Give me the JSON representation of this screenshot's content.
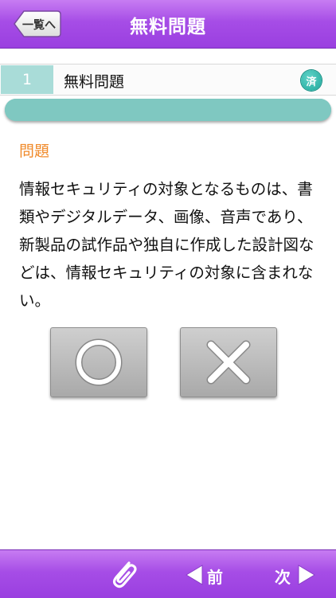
{
  "header": {
    "title": "無料問題",
    "back_label": "一覧へ"
  },
  "question": {
    "number": "1",
    "title": "無料問題",
    "status_badge": "済",
    "progress": 1.0,
    "section_label": "問題",
    "text": "情報セキュリティの対象となるものは、書類やデジタルデータ、画像、音声であり、新製品の試作品や独自に作成した設計図などは、情報セキュリティの対象に含まれない。"
  },
  "answers": {
    "true_icon": "circle-icon",
    "false_icon": "cross-icon"
  },
  "footer": {
    "clip_icon": "paperclip-icon",
    "prev_label": "前",
    "next_label": "次"
  },
  "colors": {
    "header_purple": "#a64de6",
    "accent_teal": "#7fc8c1",
    "section_orange": "#f08a2a"
  }
}
